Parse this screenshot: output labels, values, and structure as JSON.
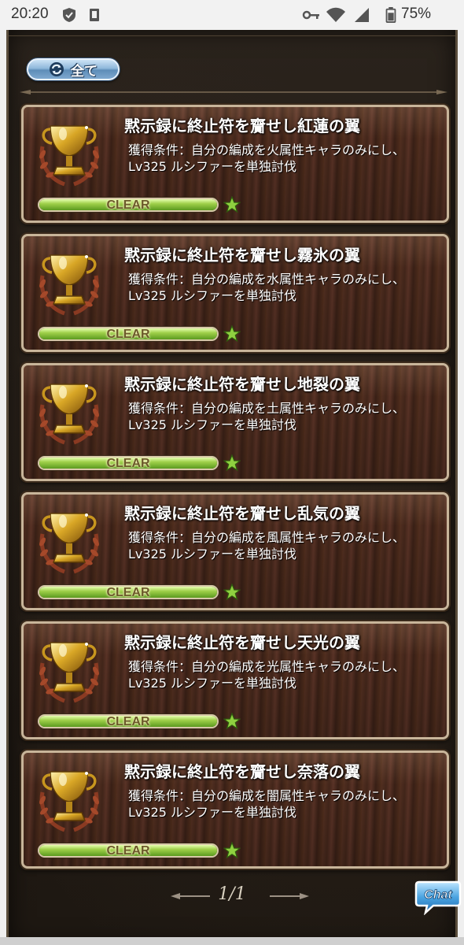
{
  "status_bar": {
    "time": "20:20",
    "battery": "75%",
    "icons": [
      "shield-check-icon",
      "sim-card-icon",
      "key-icon",
      "wifi-icon",
      "signal-icon",
      "battery-icon"
    ]
  },
  "filter": {
    "label": "全て",
    "icon": "refresh-icon",
    "color": "#7fa9cf"
  },
  "achievements": [
    {
      "title": "黙示録に終止符を齎せし紅蓮の翼",
      "desc_line1": "獲得条件：自分の編成を火属性キャラのみにし、",
      "desc_line2": "Lv325 ルシファーを単独討伐",
      "status": "CLEAR",
      "progress": 1.0,
      "stars": 1
    },
    {
      "title": "黙示録に終止符を齎せし霧氷の翼",
      "desc_line1": "獲得条件：自分の編成を水属性キャラのみにし、",
      "desc_line2": "Lv325 ルシファーを単独討伐",
      "status": "CLEAR",
      "progress": 1.0,
      "stars": 1
    },
    {
      "title": "黙示録に終止符を齎せし地裂の翼",
      "desc_line1": "獲得条件：自分の編成を土属性キャラのみにし、",
      "desc_line2": "Lv325 ルシファーを単独討伐",
      "status": "CLEAR",
      "progress": 1.0,
      "stars": 1
    },
    {
      "title": "黙示録に終止符を齎せし乱気の翼",
      "desc_line1": "獲得条件：自分の編成を風属性キャラのみにし、",
      "desc_line2": "Lv325 ルシファーを単独討伐",
      "status": "CLEAR",
      "progress": 1.0,
      "stars": 1
    },
    {
      "title": "黙示録に終止符を齎せし天光の翼",
      "desc_line1": "獲得条件：自分の編成を光属性キャラのみにし、",
      "desc_line2": "Lv325 ルシファーを単独討伐",
      "status": "CLEAR",
      "progress": 1.0,
      "stars": 1
    },
    {
      "title": "黙示録に終止符を齎せし奈落の翼",
      "desc_line1": "獲得条件：自分の編成を闇属性キャラのみにし、",
      "desc_line2": "Lv325 ルシファーを単独討伐",
      "status": "CLEAR",
      "progress": 1.0,
      "stars": 1
    }
  ],
  "pagination": {
    "text": "1/1"
  },
  "chat_button": {
    "label": "Chat",
    "icon": "chat-bubble-icon"
  },
  "colors": {
    "progress_fill": "#9fd04a",
    "star": "#8fd040",
    "card_border": "#c8b59a"
  }
}
